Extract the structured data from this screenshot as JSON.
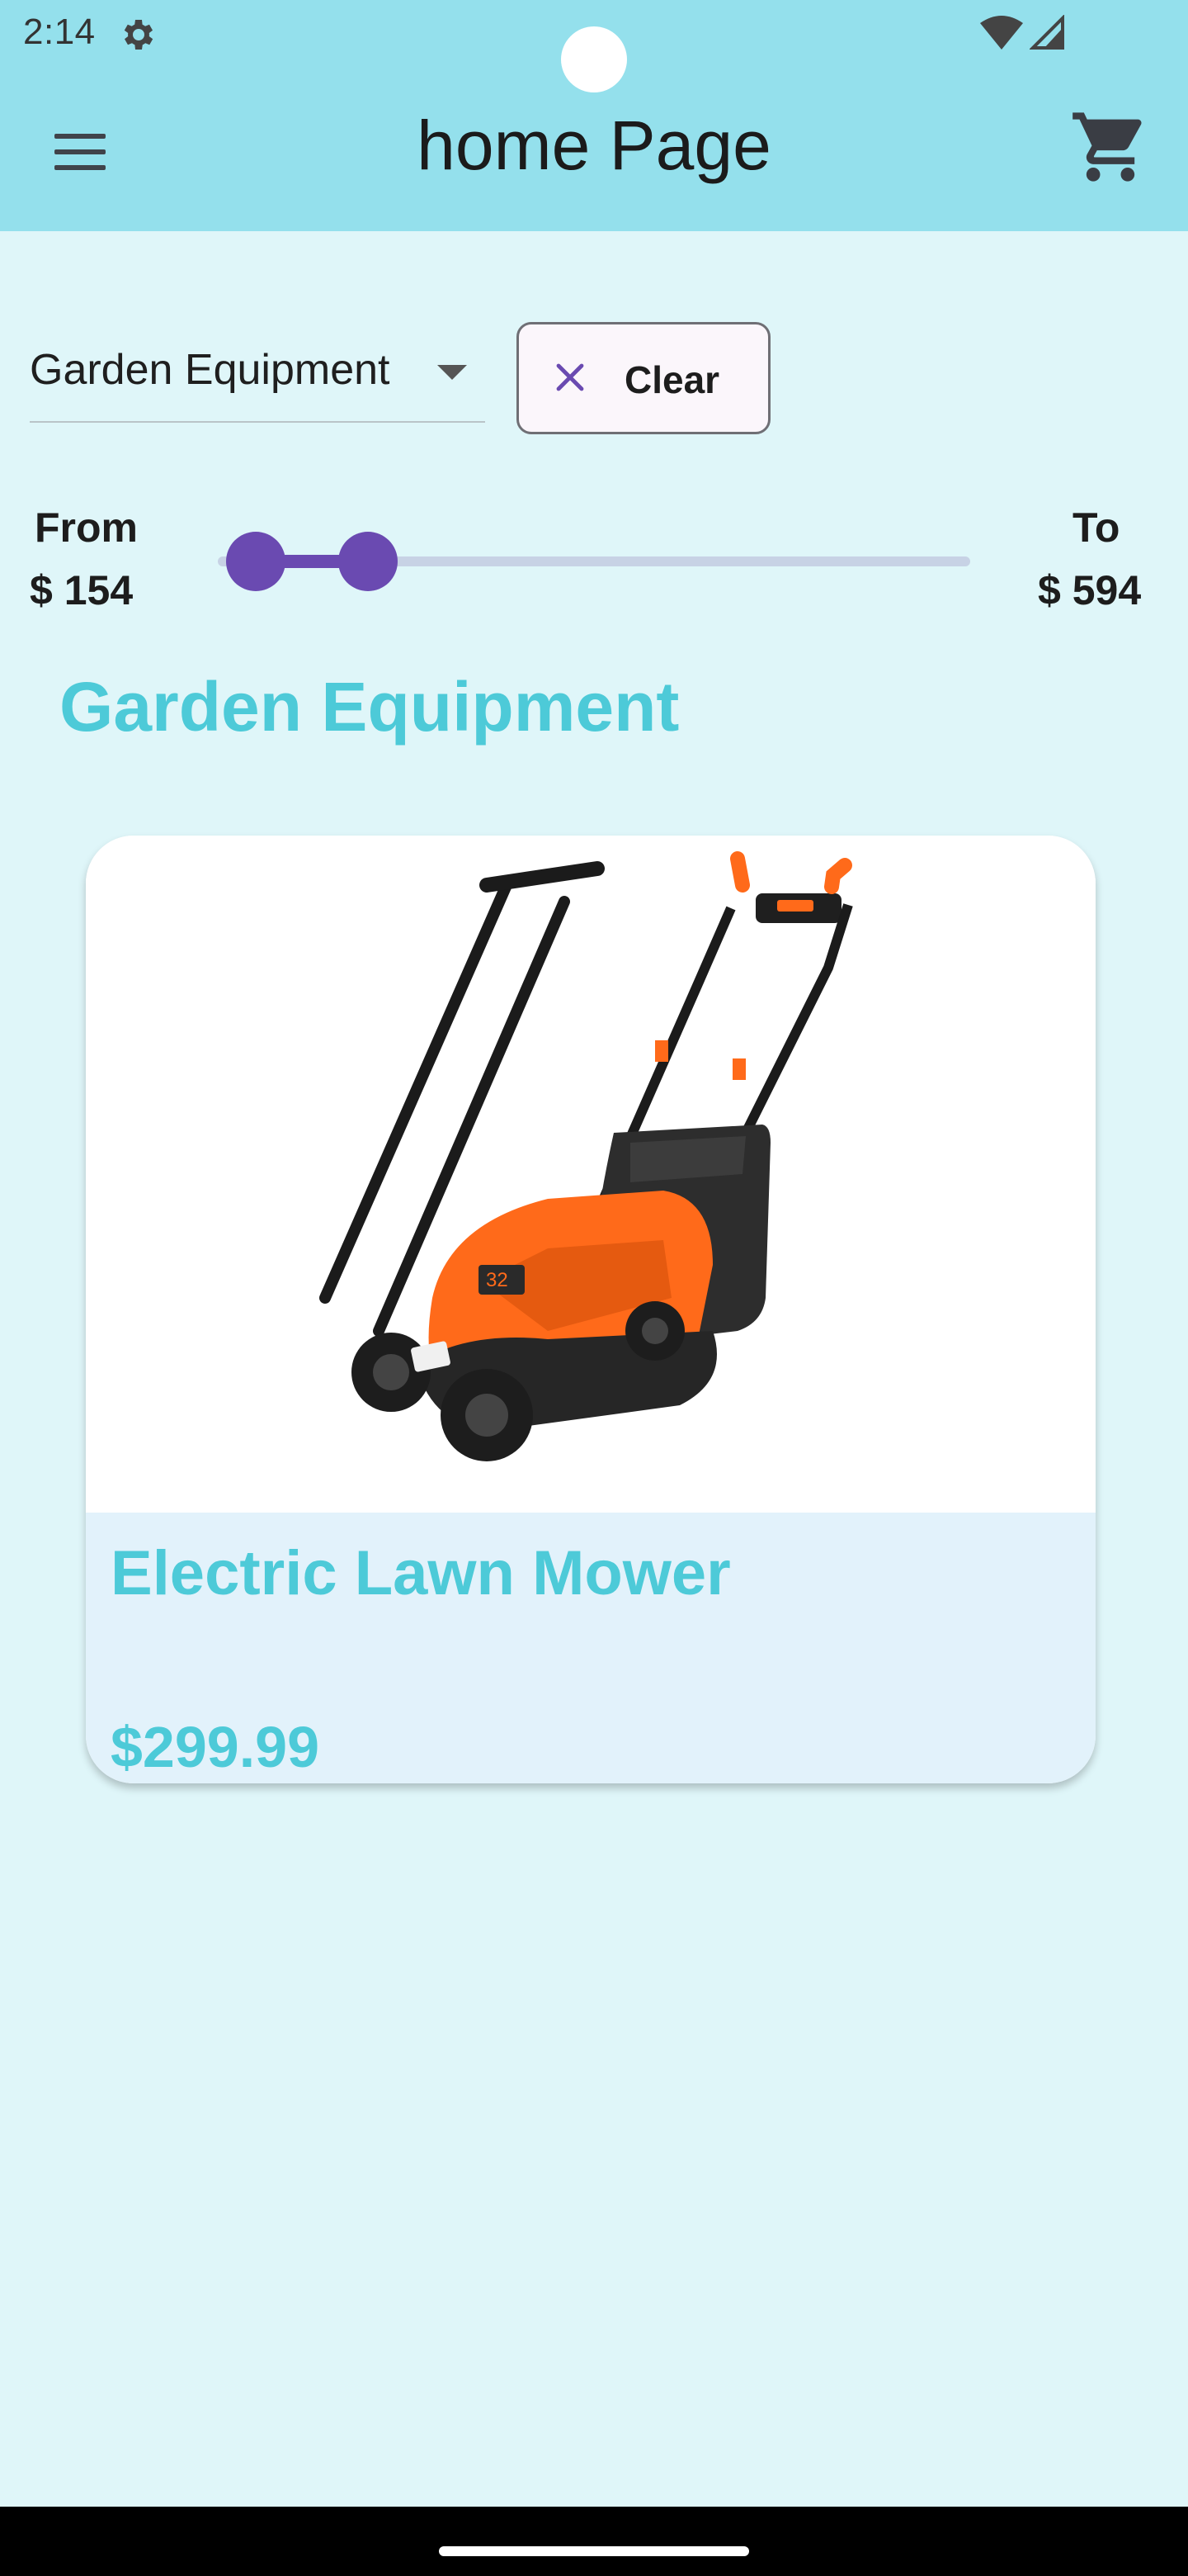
{
  "status_bar": {
    "time": "2:14",
    "icons": [
      "gear-icon",
      "wifi-icon",
      "signal-icon"
    ]
  },
  "app_bar": {
    "title": "home Page",
    "menu_icon": "menu-icon",
    "cart_icon": "cart-icon"
  },
  "filters": {
    "category_selected": "Garden Equipment",
    "clear_label": "Clear",
    "price_range": {
      "from_label": "From",
      "to_label": "To",
      "from_value": "$ 154",
      "to_value": "$ 594",
      "low_fraction": 0.05,
      "high_fraction": 0.2
    }
  },
  "section": {
    "title": "Garden Equipment"
  },
  "products": [
    {
      "name": "Electric Lawn Mower",
      "price": "$299.99",
      "image_icon": "lawn-mower-image"
    }
  ],
  "colors": {
    "app_bar": "#94e0ec",
    "background": "#dff6f9",
    "accent_text": "#4dcad8",
    "slider": "#6a4ab1"
  }
}
